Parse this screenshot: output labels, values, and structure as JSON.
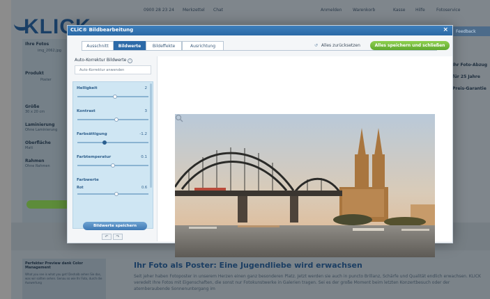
{
  "background_page": {
    "topbar": [
      "0900 28 23 24",
      "Merkzettel",
      "Chat",
      "Anmelden",
      "Warenkorb",
      "Kasse",
      "Hilfe",
      "Fotoservice",
      "Feedback"
    ],
    "logo": "KLICK",
    "left_col": {
      "fotos_label": "Ihre Fotos",
      "fotos_value": "img_2062.jpg",
      "produkt_label": "Produkt",
      "produkt_value": "Poster",
      "groesse_label": "Größe",
      "groesse_value": "30 x 20 cm",
      "laminierung_label": "Laminierung",
      "laminierung_value": "Ohne Laminierung",
      "oberflaeche_label": "Oberfläche",
      "oberflaeche_value": "Matt",
      "rahmen_label": "Rahmen",
      "rahmen_value": "Ohne Rahmen"
    },
    "right_tab": "Feedback",
    "right_col": [
      "Ihr Foto-Abzug",
      "für 25 Jahre",
      "Preis-Garantie"
    ],
    "bottom_box_title": "Perfekter Preview dank Color Management",
    "bottom_box_text": "What you see is what you get! Deshalb sehen Sie das, was wir sollten sehen. Genau so wie Ihr Foto, durch die Auswertung",
    "headline": "Ihr Foto als Poster: Eine Jugendliebe wird erwachsen",
    "paragraph": "Seit jeher haben Fotoposter in unserem Herzen einen ganz besonderen Platz. Jetzt werden sie auch in puncto Brillanz, Schärfe und Qualität endlich erwachsen. KLICK veredelt Ihre Fotos mit Eigenschaften, die sonst nur Fotokunstwerke in Galerien tragen. Sei es der große Moment beim letzten Konzertbesuch oder der atemberaubende Sonnenuntergang im"
  },
  "modal": {
    "title": "CLiC® Bildbearbeitung",
    "close": "×",
    "tabs": [
      "Ausschnitt",
      "Bildwerte",
      "Bildeffekte",
      "Ausrichtung"
    ],
    "active_tab": 1,
    "reset_label": "Alles zurücksetzen",
    "save_all_label": "Alles speichern und schließen",
    "panel_heading": "Auto-Korrektur Bildwerte",
    "auto_button": "Auto-Korrektur anwenden",
    "sliders": [
      {
        "label": "Helligkeit",
        "value": "2",
        "level": 0.53
      },
      {
        "label": "Kontrast",
        "value": "3",
        "level": 0.55
      },
      {
        "label": "Farbsättigung",
        "value": "-1.2",
        "level": 0.38
      },
      {
        "label": "Farbtemperatur",
        "value": "0.1",
        "level": 0.5
      },
      {
        "label": "Farbwerte",
        "sub_label": "Rot",
        "sub_value": "0.6",
        "level": 0.55
      }
    ],
    "undo": "↶",
    "redo": "↷",
    "save_values_label": "Bildwerte speichern"
  },
  "colors": {
    "title_bar": "#2a68a5",
    "tab_active": "#2c6aa8",
    "save_green": "#6fb83a",
    "slider_panel": "#cfe6f3"
  }
}
